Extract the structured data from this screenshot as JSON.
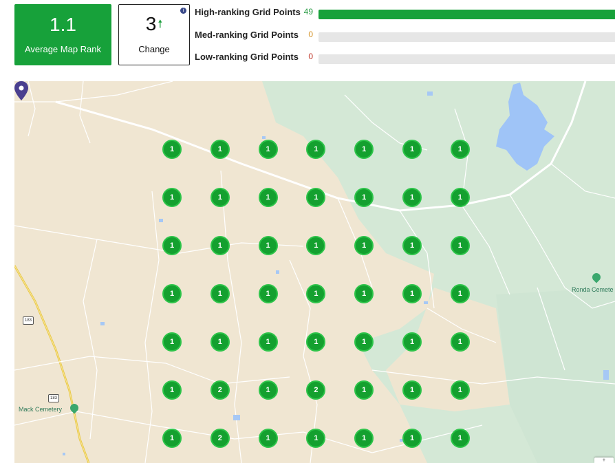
{
  "summary": {
    "average_rank": "1.1",
    "average_rank_label": "Average Map Rank",
    "change_value": "3",
    "change_arrow": "🠕",
    "change_label": "Change",
    "info_icon": "i"
  },
  "stats": [
    {
      "label": "High-ranking Grid Points",
      "count": "49",
      "fraction": 1.0,
      "color": "#2e9e4a"
    },
    {
      "label": "Med-ranking Grid Points",
      "count": "0",
      "fraction": 0,
      "color": "#d4942a"
    },
    {
      "label": "Low-ranking Grid Points",
      "count": "0",
      "fraction": 0,
      "color": "#c0392b"
    }
  ],
  "map": {
    "grid_rows": [
      [
        "1",
        "1",
        "1",
        "1",
        "1",
        "1",
        "1"
      ],
      [
        "1",
        "1",
        "1",
        "1",
        "1",
        "1",
        "1"
      ],
      [
        "1",
        "1",
        "1",
        "1",
        "1",
        "1",
        "1"
      ],
      [
        "1",
        "1",
        "1",
        "1",
        "1",
        "1",
        "1"
      ],
      [
        "1",
        "1",
        "1",
        "1",
        "1",
        "1",
        "1"
      ],
      [
        "1",
        "2",
        "1",
        "2",
        "1",
        "1",
        "1"
      ],
      [
        "1",
        "2",
        "1",
        "1",
        "1",
        "1",
        "1"
      ]
    ],
    "places": [
      {
        "name": "Mack Cemetery"
      },
      {
        "name": "Ronda Cemete"
      }
    ],
    "highway_shields": [
      "183",
      "183"
    ],
    "zoom_label": "+"
  }
}
